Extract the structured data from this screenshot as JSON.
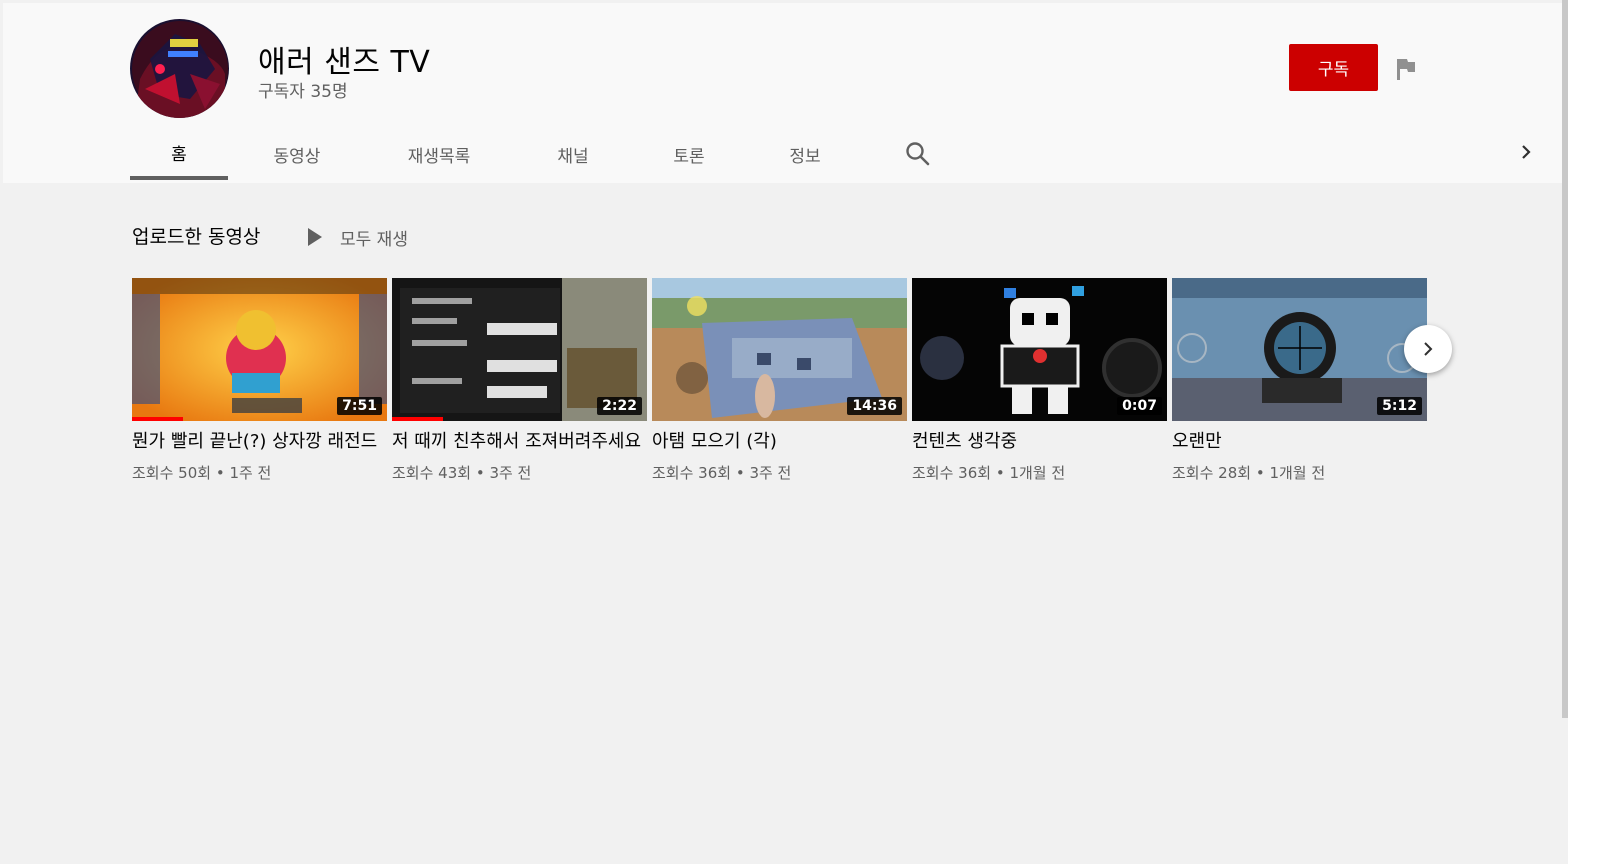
{
  "channel": {
    "name": "애러 샌즈 TV",
    "subscribers": "구독자 35명",
    "subscribe_label": "구독",
    "avatar_icon": "channel-avatar",
    "flag_icon": "flag-icon"
  },
  "tabs": [
    {
      "label": "홈",
      "active": true
    },
    {
      "label": "동영상"
    },
    {
      "label": "재생목록"
    },
    {
      "label": "채널"
    },
    {
      "label": "토론"
    },
    {
      "label": "정보"
    }
  ],
  "shelf": {
    "title": "업로드한 동영상",
    "play_all_label": "모두 재생"
  },
  "videos": [
    {
      "title": "뭔가 빨리 끝난(?) 상자깡 래전드",
      "meta": "조회수 50회 • 1주 전",
      "duration": "7:51",
      "watched": 0.2
    },
    {
      "title": "저 때끼 친추해서 조져버려주세요",
      "meta": "조회수 43회 • 3주 전",
      "duration": "2:22",
      "watched": 0.2
    },
    {
      "title": "아탬 모으기 (각)",
      "meta": "조회수 36회 • 3주 전",
      "duration": "14:36"
    },
    {
      "title": "컨텐츠 생각중",
      "meta": "조회수 36회 • 1개월 전",
      "duration": "0:07"
    },
    {
      "title": "오랜만",
      "meta": "조회수 28회 • 1개월 전",
      "duration": "5:12"
    }
  ],
  "colors": {
    "subscribe_red": "#cc0000",
    "progress_red": "#ff0000",
    "header_bg": "#f9f9f9",
    "page_bg": "#f1f1f1"
  }
}
